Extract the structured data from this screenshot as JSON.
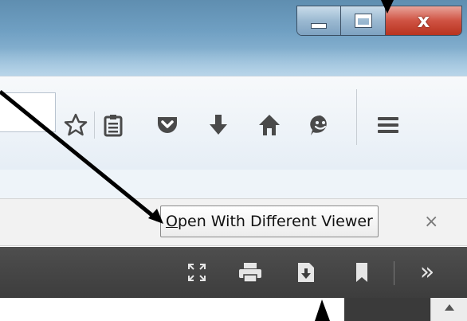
{
  "window": {
    "controls": {
      "minimize_icon": "minimize-icon",
      "maximize_icon": "maximize-icon",
      "close_icon": "close-icon",
      "close_glyph": "x"
    }
  },
  "toolbar": {
    "icons": [
      "bookmark-star-icon",
      "reading-list-icon",
      "pocket-icon",
      "downloads-icon",
      "home-icon",
      "hello-icon",
      "menu-icon"
    ]
  },
  "notification": {
    "open_button": {
      "accesskey": "O",
      "label_rest": "pen With Different Viewer"
    },
    "close_glyph": "×"
  },
  "pdf_toolbar": {
    "icons": [
      "presentation-mode-icon",
      "print-icon",
      "download-icon",
      "bookmark-icon",
      "more-tools-icon"
    ],
    "more_glyph": "»"
  },
  "colors": {
    "titlebar": "#6f9fc2",
    "close_button": "#cf5343",
    "pdf_toolbar": "#3d3d3d",
    "annotation": "#000000"
  }
}
